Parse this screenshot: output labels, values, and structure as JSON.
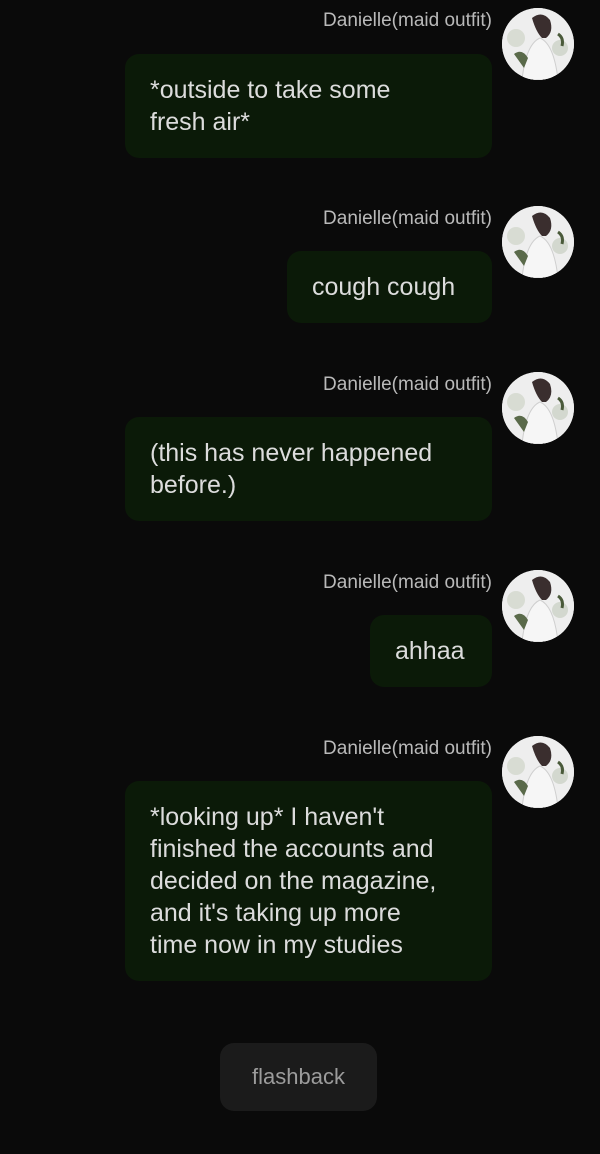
{
  "messages": [
    {
      "sender": "Danielle(maid outfit)",
      "text": "*outside to take some\nfresh air*",
      "avatar_icon": "character-avatar"
    },
    {
      "sender": "Danielle(maid outfit)",
      "text": "cough cough",
      "avatar_icon": "character-avatar"
    },
    {
      "sender": "Danielle(maid outfit)",
      "text": "(this has never happened\nbefore.)",
      "avatar_icon": "character-avatar"
    },
    {
      "sender": "Danielle(maid outfit)",
      "text": "ahhaa",
      "avatar_icon": "character-avatar"
    },
    {
      "sender": "Danielle(maid outfit)",
      "text": "*looking up* I haven't\nfinished the accounts and\ndecided on the magazine,\nand it's taking up more\ntime now in my studies",
      "avatar_icon": "character-avatar"
    }
  ],
  "flashback_button": {
    "label": "flashback"
  },
  "colors": {
    "background": "#0a0a0a",
    "bubble": "#0b1a08",
    "bubble_text": "#dcdcdc",
    "sender_text": "#b9b9b9",
    "button_bg": "#1b1b1b",
    "button_text": "#9c9c9c"
  }
}
